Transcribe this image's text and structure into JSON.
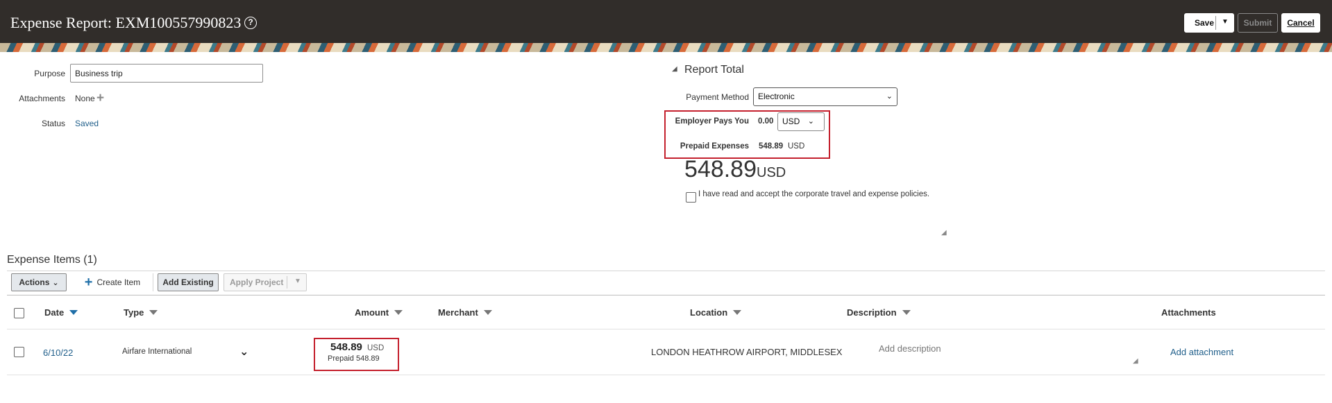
{
  "header": {
    "title": "Expense Report: EXM100557990823",
    "save_label": "Save",
    "submit_label": "Submit",
    "cancel_label": "Cancel"
  },
  "form": {
    "purpose_label": "Purpose",
    "purpose_value": "Business trip",
    "attachments_label": "Attachments",
    "attachments_value": "None",
    "status_label": "Status",
    "status_value": "Saved"
  },
  "report_total": {
    "title": "Report Total",
    "payment_method_label": "Payment Method",
    "payment_method_value": "Electronic",
    "employer_pays_label": "Employer Pays You",
    "employer_pays_amount": "0.00",
    "employer_pays_currency": "USD",
    "prepaid_label": "Prepaid Expenses",
    "prepaid_amount": "548.89",
    "prepaid_currency": "USD",
    "total_amount": "548.89",
    "total_currency": "USD",
    "policy_text": "I have read and accept the corporate travel and expense policies."
  },
  "expense_items": {
    "title": "Expense Items (1)",
    "toolbar": {
      "actions_label": "Actions",
      "create_item_label": "Create Item",
      "add_existing_label": "Add Existing",
      "apply_project_label": "Apply Project"
    },
    "columns": {
      "date": "Date",
      "type": "Type",
      "amount": "Amount",
      "merchant": "Merchant",
      "location": "Location",
      "description": "Description",
      "attachments": "Attachments"
    },
    "rows": [
      {
        "date": "6/10/22",
        "type": "Airfare International",
        "amount": "548.89",
        "currency": "USD",
        "prepaid": "Prepaid 548.89",
        "location": "LONDON HEATHROW AIRPORT, MIDDLESEX",
        "description_placeholder": "Add description",
        "attachment_link": "Add attachment"
      }
    ]
  },
  "colors": {
    "header_bg": "#312d2a",
    "link": "#1f5e8a",
    "highlight": "#c4202d"
  }
}
